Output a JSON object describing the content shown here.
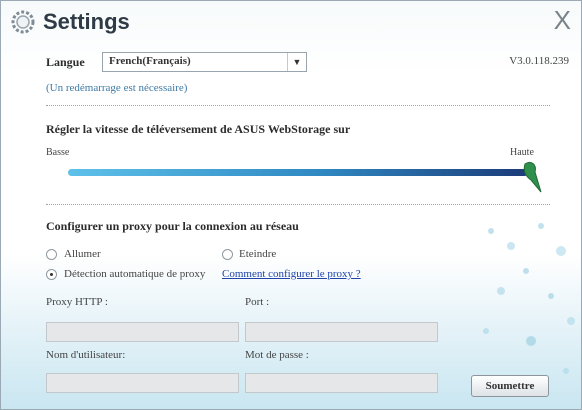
{
  "window": {
    "title": "Settings",
    "close_glyph": "X",
    "title_icon": "gear-icon"
  },
  "language": {
    "label": "Langue",
    "selected": "French(Français)",
    "note": "(Un redémarrage est nécessaire)"
  },
  "version": "V3.0.118.239",
  "speed": {
    "heading": "Régler la vitesse de téléversement de ASUS WebStorage sur",
    "low_label": "Basse",
    "high_label": "Haute",
    "level": 1.0
  },
  "proxy": {
    "heading": "Configurer un proxy pour la connexion au réseau",
    "options": {
      "on": "Allumer",
      "off": "Eteindre",
      "auto": "Détection automatique de proxy"
    },
    "selected": "auto",
    "help_link": "Comment configurer le proxy ?",
    "http_label": "Proxy HTTP :",
    "port_label": "Port :",
    "user_label": "Nom d'utilisateur:",
    "password_label": "Mot de passe :",
    "http_value": "",
    "port_value": "",
    "user_value": "",
    "password_value": ""
  },
  "submit_label": "Soumettre"
}
